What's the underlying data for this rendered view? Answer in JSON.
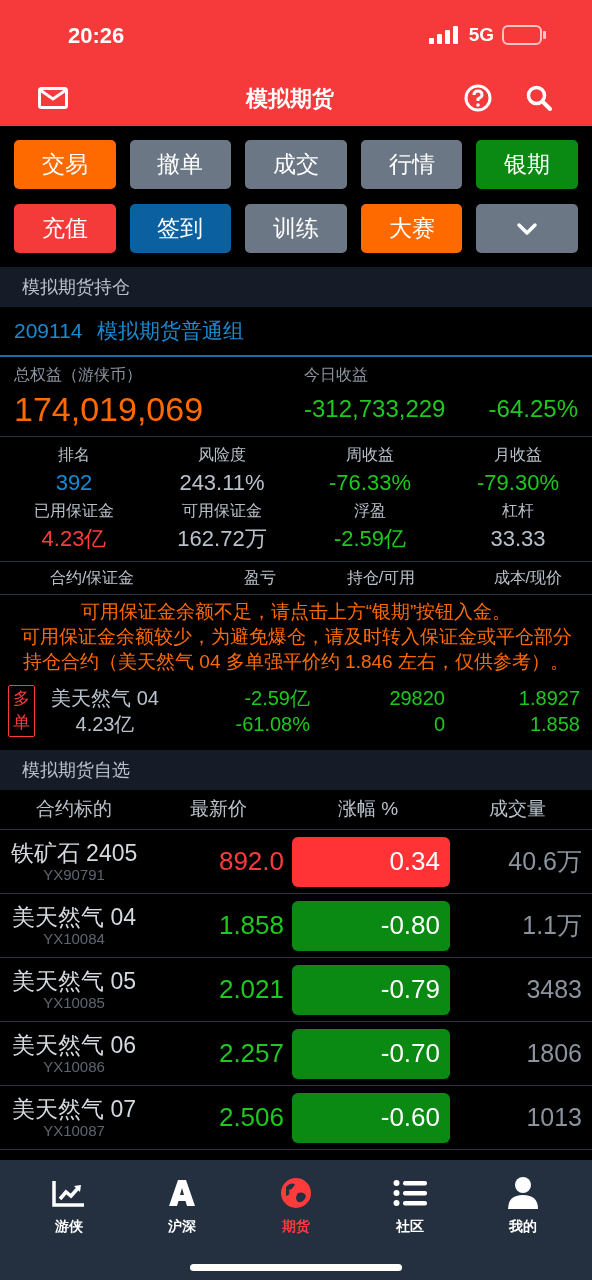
{
  "status_bar": {
    "time": "20:26",
    "network": "5G"
  },
  "header": {
    "title": "模拟期货"
  },
  "actions": [
    {
      "label": "交易",
      "color": "#ff6a00"
    },
    {
      "label": "撤单",
      "color": "#6b7785"
    },
    {
      "label": "成交",
      "color": "#6b7785"
    },
    {
      "label": "行情",
      "color": "#6b7785"
    },
    {
      "label": "银期",
      "color": "#0a8a12"
    },
    {
      "label": "充值",
      "color": "#f53a3a"
    },
    {
      "label": "签到",
      "color": "#0b60a0"
    },
    {
      "label": "训练",
      "color": "#6b7785"
    },
    {
      "label": "大赛",
      "color": "#ff6a00"
    },
    {
      "kind": "more",
      "color": "#6b7785"
    }
  ],
  "holdings": {
    "title": "模拟期货持仓",
    "account_id": "209114",
    "group": "模拟期货普通组",
    "equity_label": "总权益（游侠币）",
    "equity": "174,019,069",
    "today_label": "今日收益",
    "today_value": "-312,733,229",
    "today_pct": "-64.25%",
    "stats": [
      {
        "label": "排名",
        "value": "392",
        "color": "#1a8ad0"
      },
      {
        "label": "风险度",
        "value": "243.11%",
        "color": "#b9c2cc"
      },
      {
        "label": "周收益",
        "value": "-76.33%",
        "color": "#1fc81f"
      },
      {
        "label": "月收益",
        "value": "-79.30%",
        "color": "#1fc81f"
      },
      {
        "label": "已用保证金",
        "value": "4.23亿",
        "color": "#ff3b3b"
      },
      {
        "label": "可用保证金",
        "value": "162.72万",
        "color": "#b9c2cc"
      },
      {
        "label": "浮盈",
        "value": "-2.59亿",
        "color": "#1fc81f"
      },
      {
        "label": "杠杆",
        "value": "33.33",
        "color": "#b9c2cc"
      }
    ],
    "columns": [
      "合约/保证金",
      "盈亏",
      "持仓/可用",
      "成本/现价"
    ],
    "warnings": [
      "可用保证金余额不足，请点击上方“银期”按钮入金。",
      "可用保证金余额较少，为避免爆仓，请及时转入保证金或平仓部分持仓合约（美天然气 04 多单强平价约 1.846 左右，仅供参考）。"
    ],
    "positions": [
      {
        "side": "多单",
        "name": "美天然气 04",
        "margin": "4.23亿",
        "pnl": "-2.59亿",
        "pnl_pct": "-61.08%",
        "hold": "29820",
        "available": "0",
        "cost": "1.8927",
        "price": "1.858",
        "color": "#1fc81f"
      }
    ]
  },
  "watchlist": {
    "title": "模拟期货自选",
    "columns": [
      "合约标的",
      "最新价",
      "涨幅 %",
      "成交量"
    ],
    "rows": [
      {
        "name": "铁矿石 2405",
        "code": "YX90791",
        "price": "892.0",
        "change": "0.34",
        "volume": "40.6万",
        "color": "#ff3b3b"
      },
      {
        "name": "美天然气 04",
        "code": "YX10084",
        "price": "1.858",
        "change": "-0.80",
        "volume": "1.1万",
        "color": "#1fc81f"
      },
      {
        "name": "美天然气 05",
        "code": "YX10085",
        "price": "2.021",
        "change": "-0.79",
        "volume": "3483",
        "color": "#1fc81f"
      },
      {
        "name": "美天然气 06",
        "code": "YX10086",
        "price": "2.257",
        "change": "-0.70",
        "volume": "1806",
        "color": "#1fc81f"
      },
      {
        "name": "美天然气 07",
        "code": "YX10087",
        "price": "2.506",
        "change": "-0.60",
        "volume": "1013",
        "color": "#1fc81f"
      }
    ]
  },
  "tabs": [
    {
      "label": "游侠",
      "kind": "chart",
      "selected": false
    },
    {
      "label": "沪深",
      "kind": "letter",
      "selected": false
    },
    {
      "label": "期货",
      "kind": "globe",
      "selected": true
    },
    {
      "label": "社区",
      "kind": "list",
      "selected": false
    },
    {
      "label": "我的",
      "kind": "person",
      "selected": false
    }
  ]
}
